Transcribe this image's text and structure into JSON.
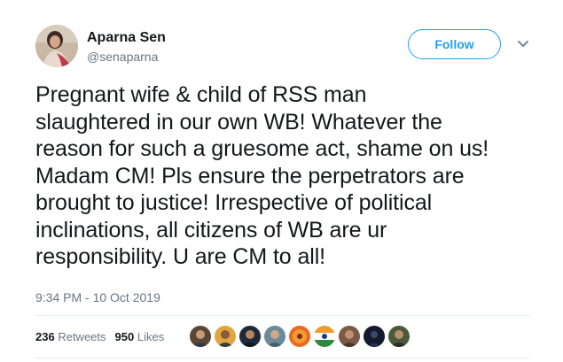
{
  "author": {
    "display_name": "Aparna Sen",
    "handle": "@senaparna"
  },
  "follow_label": "Follow",
  "tweet_text": "Pregnant wife & child of RSS man\nslaughtered in our own WB! Whatever the\nreason for such a gruesome act, shame on us!\nMadam CM! Pls ensure the perpetrators are\nbrought to justice! Irrespective of political\ninclinations, all citizens of WB are ur\nresponsibility. U are CM to all!",
  "timestamp": "9:34 PM - 10 Oct 2019",
  "stats": {
    "retweets_count": "236",
    "retweets_label": "Retweets",
    "likes_count": "950",
    "likes_label": "Likes"
  },
  "colors": {
    "accent": "#1da1f2",
    "text": "#14171a",
    "secondary": "#657786",
    "divider": "#e6ecf0"
  },
  "icons": [
    "chevron-down-icon"
  ]
}
